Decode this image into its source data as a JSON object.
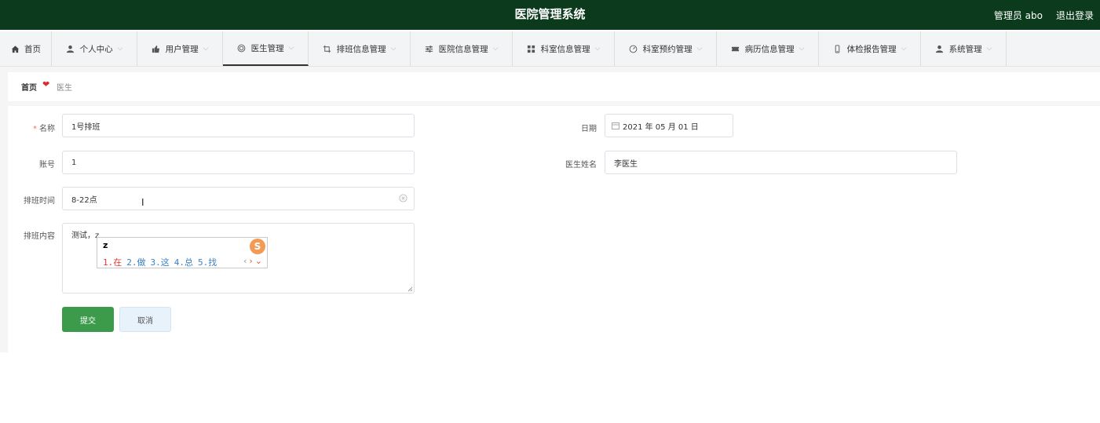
{
  "header": {
    "title": "医院管理系统",
    "user": "管理员 abo",
    "logout": "退出登录"
  },
  "nav": {
    "items": [
      {
        "label": "首页",
        "icon": "home-icon"
      },
      {
        "label": "个人中心",
        "icon": "person-icon"
      },
      {
        "label": "用户管理",
        "icon": "thumb-icon"
      },
      {
        "label": "医生管理",
        "icon": "circle-icon"
      },
      {
        "label": "排班信息管理",
        "icon": "crop-icon"
      },
      {
        "label": "医院信息管理",
        "icon": "sliders-icon"
      },
      {
        "label": "科室信息管理",
        "icon": "grid-icon"
      },
      {
        "label": "科室预约管理",
        "icon": "gauge-icon"
      },
      {
        "label": "病历信息管理",
        "icon": "ticket-icon"
      },
      {
        "label": "体检报告管理",
        "icon": "phone-icon"
      },
      {
        "label": "系统管理",
        "icon": "person-icon"
      }
    ]
  },
  "breadcrumb": {
    "home": "首页",
    "current": "医生"
  },
  "form": {
    "name_label": "名称",
    "name_value": "1号排班",
    "date_label": "日期",
    "date_value": "2021 年 05 月 01 日",
    "account_label": "账号",
    "account_value": "1",
    "doctor_label": "医生姓名",
    "doctor_value": "李医生",
    "time_label": "排班时间",
    "time_value": "8-22点",
    "content_label": "排班内容",
    "content_value": "测试，z",
    "submit": "提交",
    "cancel": "取消"
  },
  "ime": {
    "typed": "z",
    "logo": "S",
    "candidates": [
      "1.在",
      "2.做",
      "3.这",
      "4.总",
      "5.找"
    ]
  },
  "colors": {
    "header_bg": "#0b3a1c",
    "primary": "#3c9b4b",
    "required": "#f56c6c"
  }
}
